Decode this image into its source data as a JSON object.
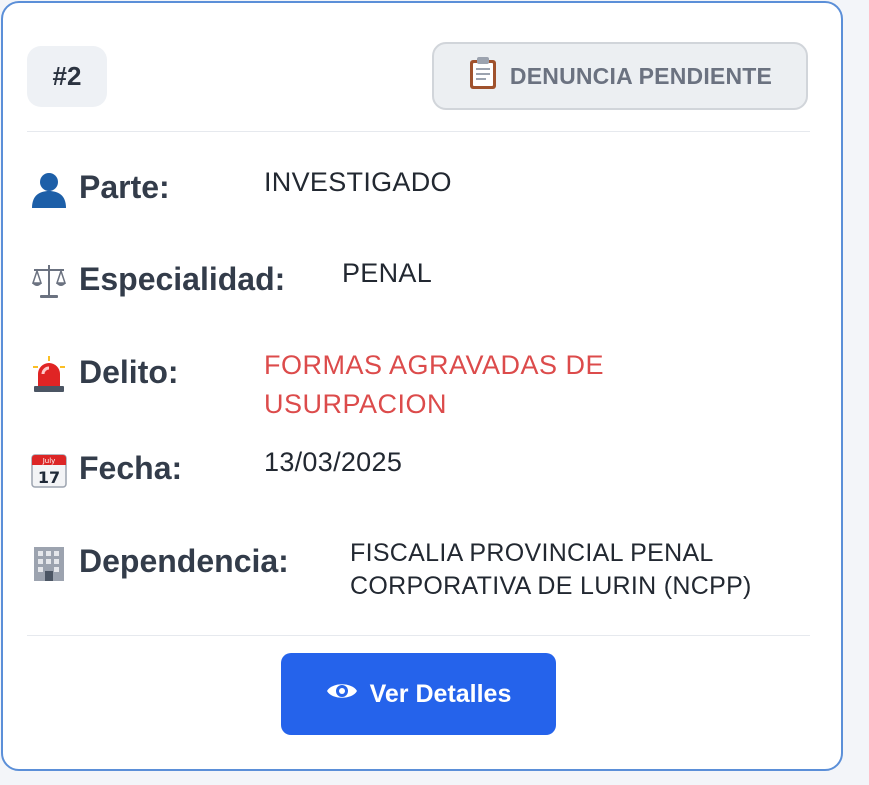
{
  "card": {
    "number_badge": "#2",
    "status": {
      "label": "DENUNCIA PENDIENTE",
      "icon": "clipboard-icon"
    },
    "fields": {
      "parte": {
        "label": "Parte:",
        "value": "INVESTIGADO",
        "icon": "person-icon"
      },
      "especialidad": {
        "label": "Especialidad:",
        "value": "PENAL",
        "icon": "scales-icon"
      },
      "delito": {
        "label": "Delito:",
        "value_line1": "FORMAS AGRAVADAS DE",
        "value_line2": "USURPACION",
        "icon": "siren-icon"
      },
      "fecha": {
        "label": "Fecha:",
        "value": "13/03/2025",
        "icon": "calendar-icon"
      },
      "dependencia": {
        "label": "Dependencia:",
        "value_line1": "FISCALIA PROVINCIAL PENAL",
        "value_line2": "CORPORATIVA DE LURIN (NCPP)",
        "icon": "building-icon"
      }
    },
    "action": {
      "label": "Ver Detalles",
      "icon": "eye-icon"
    },
    "colors": {
      "accent": "#2563eb",
      "delito_text": "#dc4b4b",
      "card_border": "#5b8fd8",
      "status_bg": "#eceff2"
    }
  }
}
